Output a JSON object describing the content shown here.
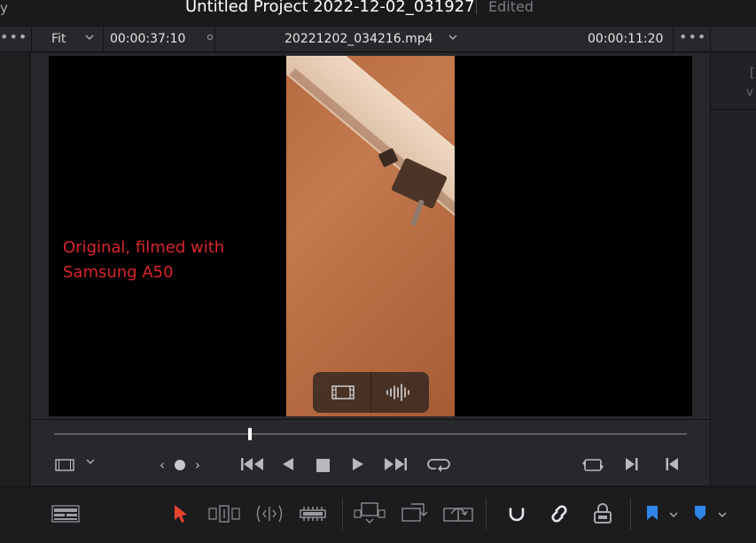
{
  "title_bar": {
    "left_glyph": "y",
    "project_title": "Untitled Project 2022-12-02_031927",
    "status": "Edited"
  },
  "viewer_header": {
    "more_left": "•••",
    "zoom": "Fit",
    "source_timecode": "00:00:37:10",
    "clip_name": "20221202_034216.mp4",
    "clip_timecode": "00:00:11:20",
    "more_right": "•••"
  },
  "right_panel": {
    "glyph_1": "[",
    "glyph_2": "v"
  },
  "viewer": {
    "caption_line1": "Original, filmed with",
    "caption_line2": "Samsung A50",
    "caption_color": "#d8252b",
    "overlay_icons": [
      "video-only-icon",
      "audio-only-icon"
    ]
  },
  "transport": {
    "playhead_fraction": 0.31,
    "jog_prev": "‹",
    "jog_next": "›",
    "icons": [
      "viewer-mode-icon",
      "first-frame-icon",
      "reverse-play-icon",
      "stop-icon",
      "play-icon",
      "last-frame-icon",
      "loop-icon",
      "match-frame-icon",
      "mark-in-icon",
      "mark-out-icon"
    ]
  },
  "toolbar": {
    "icons": [
      "timeline-view-icon",
      "selection-arrow-icon",
      "trim-edit-icon",
      "dynamic-trim-icon",
      "blade-icon",
      "insert-clip-icon",
      "overwrite-clip-icon",
      "replace-clip-icon",
      "snapping-icon",
      "linked-selection-icon",
      "position-lock-icon",
      "flag-icon",
      "marker-icon"
    ],
    "accent_color": "#e8432f",
    "flag_color": "#2f86e8"
  }
}
